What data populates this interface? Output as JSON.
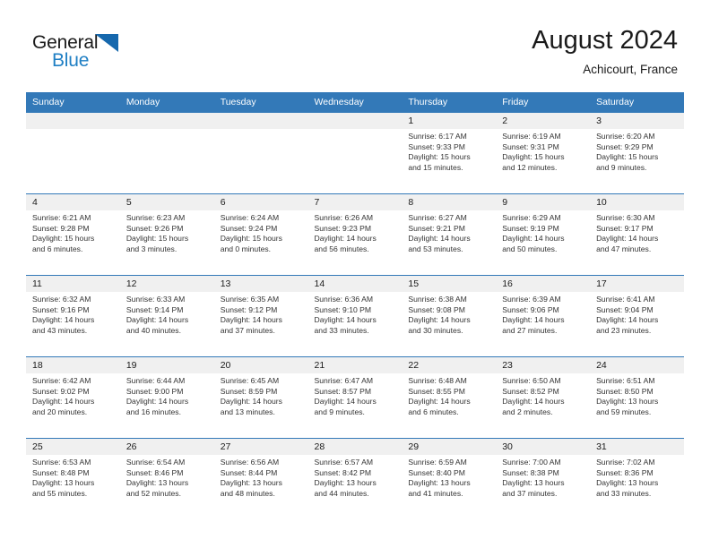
{
  "brand": {
    "name_part1": "General",
    "name_part2": "Blue",
    "accent_color": "#1f7fc4",
    "triangle_color": "#1668ad"
  },
  "header": {
    "title": "August 2024",
    "subtitle": "Achicourt, France"
  },
  "theme": {
    "header_row_bg": "#3379b8",
    "day_band_bg": "#f0f0f0",
    "text_color": "#1a1a1a"
  },
  "columns": [
    "Sunday",
    "Monday",
    "Tuesday",
    "Wednesday",
    "Thursday",
    "Friday",
    "Saturday"
  ],
  "weeks": [
    [
      {
        "day": "",
        "empty": true
      },
      {
        "day": "",
        "empty": true
      },
      {
        "day": "",
        "empty": true
      },
      {
        "day": "",
        "empty": true
      },
      {
        "day": "1",
        "sunrise": "Sunrise: 6:17 AM",
        "sunset": "Sunset: 9:33 PM",
        "daylight1": "Daylight: 15 hours",
        "daylight2": "and 15 minutes."
      },
      {
        "day": "2",
        "sunrise": "Sunrise: 6:19 AM",
        "sunset": "Sunset: 9:31 PM",
        "daylight1": "Daylight: 15 hours",
        "daylight2": "and 12 minutes."
      },
      {
        "day": "3",
        "sunrise": "Sunrise: 6:20 AM",
        "sunset": "Sunset: 9:29 PM",
        "daylight1": "Daylight: 15 hours",
        "daylight2": "and 9 minutes."
      }
    ],
    [
      {
        "day": "4",
        "sunrise": "Sunrise: 6:21 AM",
        "sunset": "Sunset: 9:28 PM",
        "daylight1": "Daylight: 15 hours",
        "daylight2": "and 6 minutes."
      },
      {
        "day": "5",
        "sunrise": "Sunrise: 6:23 AM",
        "sunset": "Sunset: 9:26 PM",
        "daylight1": "Daylight: 15 hours",
        "daylight2": "and 3 minutes."
      },
      {
        "day": "6",
        "sunrise": "Sunrise: 6:24 AM",
        "sunset": "Sunset: 9:24 PM",
        "daylight1": "Daylight: 15 hours",
        "daylight2": "and 0 minutes."
      },
      {
        "day": "7",
        "sunrise": "Sunrise: 6:26 AM",
        "sunset": "Sunset: 9:23 PM",
        "daylight1": "Daylight: 14 hours",
        "daylight2": "and 56 minutes."
      },
      {
        "day": "8",
        "sunrise": "Sunrise: 6:27 AM",
        "sunset": "Sunset: 9:21 PM",
        "daylight1": "Daylight: 14 hours",
        "daylight2": "and 53 minutes."
      },
      {
        "day": "9",
        "sunrise": "Sunrise: 6:29 AM",
        "sunset": "Sunset: 9:19 PM",
        "daylight1": "Daylight: 14 hours",
        "daylight2": "and 50 minutes."
      },
      {
        "day": "10",
        "sunrise": "Sunrise: 6:30 AM",
        "sunset": "Sunset: 9:17 PM",
        "daylight1": "Daylight: 14 hours",
        "daylight2": "and 47 minutes."
      }
    ],
    [
      {
        "day": "11",
        "sunrise": "Sunrise: 6:32 AM",
        "sunset": "Sunset: 9:16 PM",
        "daylight1": "Daylight: 14 hours",
        "daylight2": "and 43 minutes."
      },
      {
        "day": "12",
        "sunrise": "Sunrise: 6:33 AM",
        "sunset": "Sunset: 9:14 PM",
        "daylight1": "Daylight: 14 hours",
        "daylight2": "and 40 minutes."
      },
      {
        "day": "13",
        "sunrise": "Sunrise: 6:35 AM",
        "sunset": "Sunset: 9:12 PM",
        "daylight1": "Daylight: 14 hours",
        "daylight2": "and 37 minutes."
      },
      {
        "day": "14",
        "sunrise": "Sunrise: 6:36 AM",
        "sunset": "Sunset: 9:10 PM",
        "daylight1": "Daylight: 14 hours",
        "daylight2": "and 33 minutes."
      },
      {
        "day": "15",
        "sunrise": "Sunrise: 6:38 AM",
        "sunset": "Sunset: 9:08 PM",
        "daylight1": "Daylight: 14 hours",
        "daylight2": "and 30 minutes."
      },
      {
        "day": "16",
        "sunrise": "Sunrise: 6:39 AM",
        "sunset": "Sunset: 9:06 PM",
        "daylight1": "Daylight: 14 hours",
        "daylight2": "and 27 minutes."
      },
      {
        "day": "17",
        "sunrise": "Sunrise: 6:41 AM",
        "sunset": "Sunset: 9:04 PM",
        "daylight1": "Daylight: 14 hours",
        "daylight2": "and 23 minutes."
      }
    ],
    [
      {
        "day": "18",
        "sunrise": "Sunrise: 6:42 AM",
        "sunset": "Sunset: 9:02 PM",
        "daylight1": "Daylight: 14 hours",
        "daylight2": "and 20 minutes."
      },
      {
        "day": "19",
        "sunrise": "Sunrise: 6:44 AM",
        "sunset": "Sunset: 9:00 PM",
        "daylight1": "Daylight: 14 hours",
        "daylight2": "and 16 minutes."
      },
      {
        "day": "20",
        "sunrise": "Sunrise: 6:45 AM",
        "sunset": "Sunset: 8:59 PM",
        "daylight1": "Daylight: 14 hours",
        "daylight2": "and 13 minutes."
      },
      {
        "day": "21",
        "sunrise": "Sunrise: 6:47 AM",
        "sunset": "Sunset: 8:57 PM",
        "daylight1": "Daylight: 14 hours",
        "daylight2": "and 9 minutes."
      },
      {
        "day": "22",
        "sunrise": "Sunrise: 6:48 AM",
        "sunset": "Sunset: 8:55 PM",
        "daylight1": "Daylight: 14 hours",
        "daylight2": "and 6 minutes."
      },
      {
        "day": "23",
        "sunrise": "Sunrise: 6:50 AM",
        "sunset": "Sunset: 8:52 PM",
        "daylight1": "Daylight: 14 hours",
        "daylight2": "and 2 minutes."
      },
      {
        "day": "24",
        "sunrise": "Sunrise: 6:51 AM",
        "sunset": "Sunset: 8:50 PM",
        "daylight1": "Daylight: 13 hours",
        "daylight2": "and 59 minutes."
      }
    ],
    [
      {
        "day": "25",
        "sunrise": "Sunrise: 6:53 AM",
        "sunset": "Sunset: 8:48 PM",
        "daylight1": "Daylight: 13 hours",
        "daylight2": "and 55 minutes."
      },
      {
        "day": "26",
        "sunrise": "Sunrise: 6:54 AM",
        "sunset": "Sunset: 8:46 PM",
        "daylight1": "Daylight: 13 hours",
        "daylight2": "and 52 minutes."
      },
      {
        "day": "27",
        "sunrise": "Sunrise: 6:56 AM",
        "sunset": "Sunset: 8:44 PM",
        "daylight1": "Daylight: 13 hours",
        "daylight2": "and 48 minutes."
      },
      {
        "day": "28",
        "sunrise": "Sunrise: 6:57 AM",
        "sunset": "Sunset: 8:42 PM",
        "daylight1": "Daylight: 13 hours",
        "daylight2": "and 44 minutes."
      },
      {
        "day": "29",
        "sunrise": "Sunrise: 6:59 AM",
        "sunset": "Sunset: 8:40 PM",
        "daylight1": "Daylight: 13 hours",
        "daylight2": "and 41 minutes."
      },
      {
        "day": "30",
        "sunrise": "Sunrise: 7:00 AM",
        "sunset": "Sunset: 8:38 PM",
        "daylight1": "Daylight: 13 hours",
        "daylight2": "and 37 minutes."
      },
      {
        "day": "31",
        "sunrise": "Sunrise: 7:02 AM",
        "sunset": "Sunset: 8:36 PM",
        "daylight1": "Daylight: 13 hours",
        "daylight2": "and 33 minutes."
      }
    ]
  ]
}
